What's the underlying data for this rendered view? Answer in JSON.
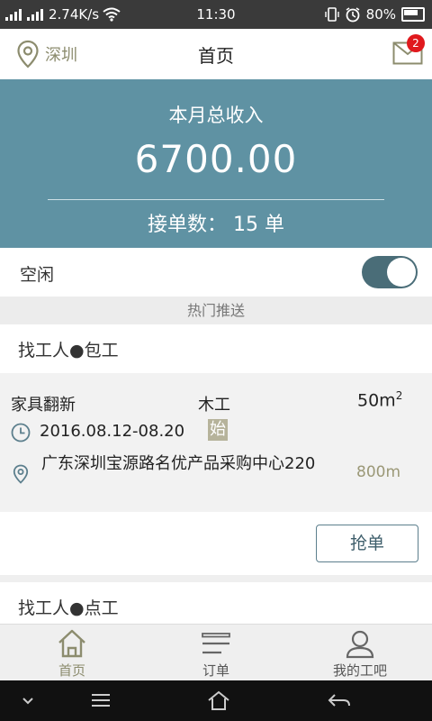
{
  "status_bar": {
    "network_speed": "2.74K/s",
    "time": "11:30",
    "battery": "80%",
    "signal_labels": [
      "2G",
      "4G"
    ]
  },
  "app_bar": {
    "location": "深圳",
    "title": "首页",
    "message_count": "2"
  },
  "income": {
    "label": "本月总收入",
    "amount": "6700.00",
    "orders_text": "接单数： 15 单"
  },
  "work_status": {
    "label": "空闲",
    "toggle_on": true
  },
  "hot_push_label": "热门推送",
  "section_package": {
    "title": "找工人●包工"
  },
  "order_card": {
    "name": "家具翻新",
    "type": "木工",
    "area": "50m",
    "area_sup": "2",
    "date_range": "2016.08.12-08.20",
    "start_tag": "始",
    "address": "广东深圳宝源路名优产品采购中心220",
    "distance": "800m",
    "grab_label": "抢单"
  },
  "section_point": {
    "title": "找工人●点工"
  },
  "tabs": [
    {
      "label": "首页",
      "icon": "home-icon",
      "active": true
    },
    {
      "label": "订单",
      "icon": "list-icon",
      "active": false
    },
    {
      "label": "我的工吧",
      "icon": "user-icon",
      "active": false
    }
  ],
  "colors": {
    "banner": "#5f92a3",
    "accent_olive": "#8c8c6e",
    "toggle": "#4a6d78",
    "badge": "#e0191d"
  }
}
